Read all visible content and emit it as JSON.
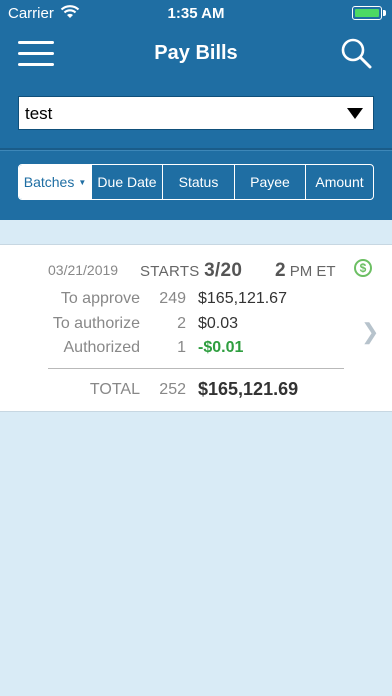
{
  "status_bar": {
    "carrier": "Carrier",
    "time": "1:35 AM"
  },
  "header": {
    "title": "Pay Bills",
    "menu_icon": "hamburger-menu-icon",
    "search_icon": "search-icon"
  },
  "filter": {
    "selected": "test"
  },
  "tabs": [
    {
      "label": "Batches",
      "active": true
    },
    {
      "label": "Due Date",
      "active": false
    },
    {
      "label": "Status",
      "active": false
    },
    {
      "label": "Payee",
      "active": false
    },
    {
      "label": "Amount",
      "active": false
    }
  ],
  "batch": {
    "date": "03/21/2019",
    "starts_label": "STARTS",
    "starts_date": "3/20",
    "start_hour": "2",
    "start_suffix": "PM ET",
    "rows": [
      {
        "label": "To approve",
        "count": "249",
        "amount": "$165,121.67"
      },
      {
        "label": "To authorize",
        "count": "2",
        "amount": "$0.03"
      },
      {
        "label": "Authorized",
        "count": "1",
        "amount": "-$0.01"
      }
    ],
    "total_label": "TOTAL",
    "total_count": "252",
    "total_amount": "$165,121.69"
  },
  "colors": {
    "brand": "#1f6ea3",
    "background": "#d9ebf6",
    "positive_green": "#2e9e3f",
    "icon_green": "#6cbf63"
  }
}
